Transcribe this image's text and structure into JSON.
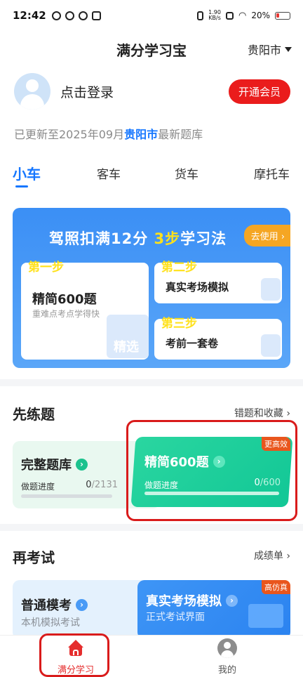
{
  "status_bar": {
    "time": "12:42",
    "net_speed": "1.90",
    "net_unit": "KB/s",
    "battery": "20%"
  },
  "header": {
    "title": "满分学习宝",
    "city": "贵阳市"
  },
  "login": {
    "text": "点击登录",
    "vip_button": "开通会员"
  },
  "update": {
    "prefix": "已更新至2025年09月",
    "city": "贵阳市",
    "suffix": "最新题库"
  },
  "tabs": [
    "小车",
    "客车",
    "货车",
    "摩托车"
  ],
  "banner": {
    "title_pre": "驾照扣满12分 ",
    "title_hl": "3步",
    "title_post": "学习法",
    "button": "去使用",
    "step1_label": "第一步",
    "step1_title": "精简600题",
    "step1_sub": "重难点考点学得快",
    "step1_deco": "精选",
    "step2_label": "第二步",
    "step2_title": "真实考场模拟",
    "step3_label": "第三步",
    "step3_title": "考前一套卷"
  },
  "practice": {
    "title": "先练题",
    "link": "错题和收藏",
    "full_bank": {
      "title": "完整题库",
      "progress_label": "做题进度",
      "done": "0",
      "total": "2131"
    },
    "jingjian": {
      "title": "精简600题",
      "badge": "更高效",
      "progress_label": "做题进度",
      "done": "0",
      "total": "600"
    }
  },
  "exam": {
    "title": "再考试",
    "link": "成绩单",
    "mock": {
      "title": "普通模考",
      "sub": "本机模拟考试"
    },
    "real": {
      "title": "真实考场模拟",
      "sub": "正式考试界面",
      "badge": "高仿真"
    }
  },
  "nav": {
    "home": "满分学习",
    "me": "我的"
  },
  "colors": {
    "accent": "#1677ff",
    "vip_red": "#ea1c1c",
    "green": "#12c796",
    "highlight_outline": "#d91b1b"
  }
}
